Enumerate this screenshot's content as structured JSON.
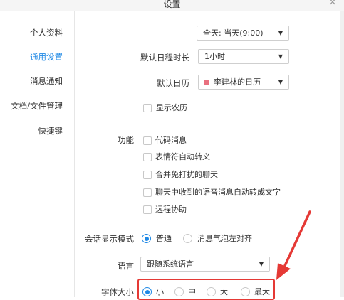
{
  "window": {
    "title": "设置",
    "close_glyph": "×"
  },
  "sidebar": {
    "items": [
      {
        "label": "个人资料",
        "active": false
      },
      {
        "label": "通用设置",
        "active": true
      },
      {
        "label": "消息通知",
        "active": false
      },
      {
        "label": "文档/文件管理",
        "active": false
      },
      {
        "label": "快捷键",
        "active": false
      }
    ]
  },
  "settings": {
    "allday_select": {
      "value": "全天: 当天(9:00)"
    },
    "default_duration": {
      "label": "默认日程时长",
      "value": "1小时"
    },
    "default_calendar": {
      "label": "默认日历",
      "value": "李建林的日历",
      "color": "#e9707f"
    },
    "lunar": {
      "label": "显示农历",
      "checked": false
    },
    "features": {
      "label": "功能",
      "options": [
        {
          "label": "代码消息",
          "checked": false
        },
        {
          "label": "表情符自动转义",
          "checked": false
        },
        {
          "label": "合并免打扰的聊天",
          "checked": false
        },
        {
          "label": "聊天中收到的语音消息自动转成文字",
          "checked": false
        },
        {
          "label": "远程协助",
          "checked": false
        }
      ]
    },
    "display_mode": {
      "label": "会话显示模式",
      "options": [
        {
          "label": "普通",
          "checked": true
        },
        {
          "label": "消息气泡左对齐",
          "checked": false
        }
      ]
    },
    "language": {
      "label": "语言",
      "value": "跟随系统语言"
    },
    "font_size": {
      "label": "字体大小",
      "options": [
        {
          "label": "小",
          "checked": true
        },
        {
          "label": "中",
          "checked": false
        },
        {
          "label": "大",
          "checked": false
        },
        {
          "label": "最大",
          "checked": false
        }
      ]
    }
  },
  "colors": {
    "accent": "#1e88e5",
    "annotation": "#e53935",
    "dropdown_arrow": "▼"
  }
}
